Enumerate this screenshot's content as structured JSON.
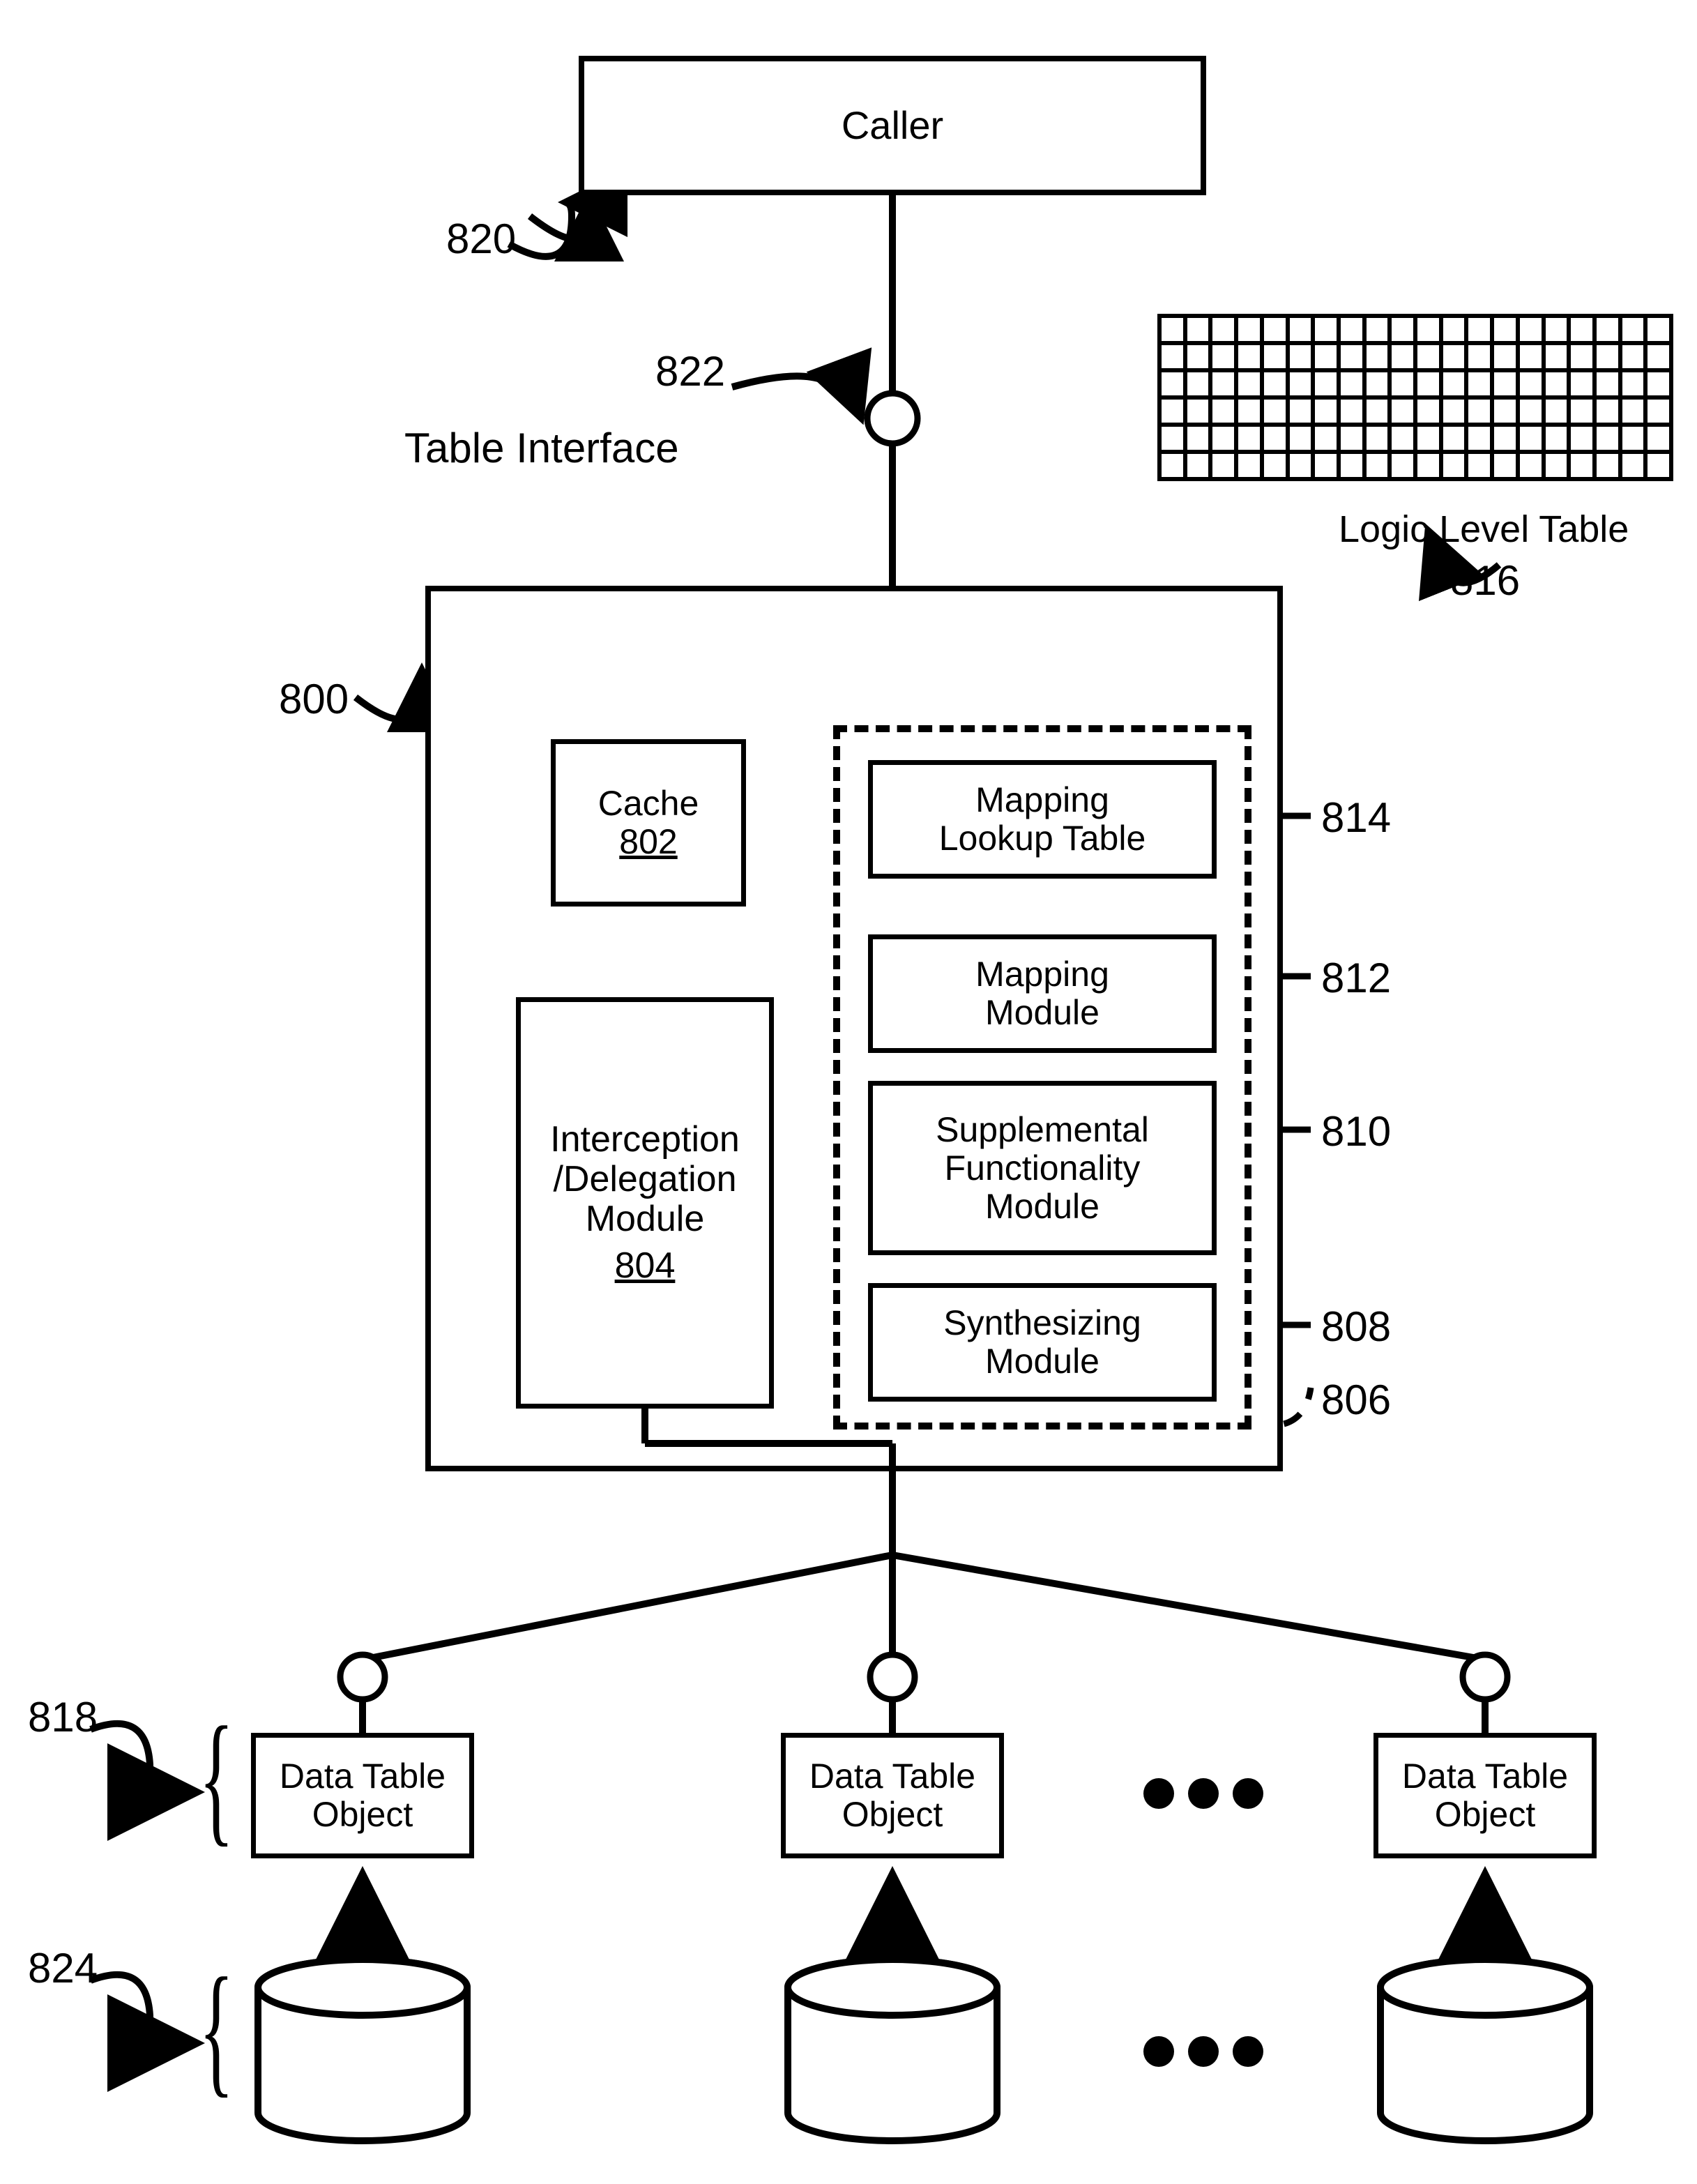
{
  "caller": {
    "label": "Caller",
    "ref": "820"
  },
  "table_interface": {
    "label": "Table Interface",
    "ref": "822"
  },
  "logic_level_table": {
    "label": "Logic Level Table",
    "ref": "816",
    "rows": 6,
    "cols": 20
  },
  "system": {
    "ref": "800"
  },
  "cache": {
    "label": "Cache",
    "ref": "802"
  },
  "interception_delegation": {
    "label": "Interception\n/Delegation\nModule",
    "ref": "804"
  },
  "mapping_lookup": {
    "label": "Mapping\nLookup Table",
    "ref": "814"
  },
  "mapping_module": {
    "label": "Mapping\nModule",
    "ref": "812"
  },
  "supplemental": {
    "label": "Supplemental\nFunctionality\nModule",
    "ref": "810"
  },
  "synthesizing": {
    "label": "Synthesizing\nModule",
    "ref": "808"
  },
  "preprocessor_group": {
    "ref": "806"
  },
  "data_table_object": {
    "label": "Data Table\nObject",
    "ref": "818"
  },
  "data_sources": {
    "ref": "824"
  }
}
